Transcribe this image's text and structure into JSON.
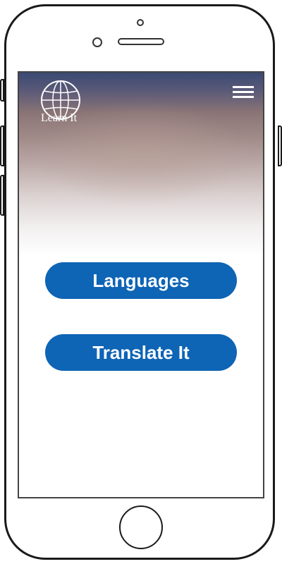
{
  "app": {
    "logo_text": "Learn It",
    "menu_icon": "hamburger-menu-icon",
    "logo_icon": "globe-icon"
  },
  "actions": {
    "languages_label": "Languages",
    "translate_label": "Translate It"
  },
  "colors": {
    "button_bg": "#0e64b5",
    "button_text": "#ffffff",
    "hero_top": "#3a4a74"
  }
}
